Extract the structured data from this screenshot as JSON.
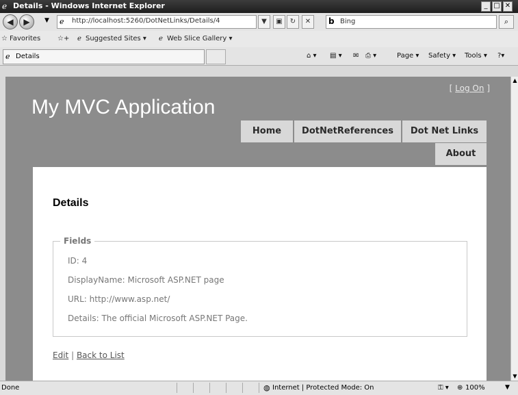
{
  "window": {
    "title": "Details - Windows Internet Explorer"
  },
  "address": {
    "url": "http://localhost:5260/DotNetLinks/Details/4",
    "search_placeholder": "Bing"
  },
  "favorites_bar": {
    "favorites": "Favorites",
    "suggested": "Suggested Sites ▾",
    "webslice": "Web Slice Gallery ▾"
  },
  "tab": {
    "label": "Details"
  },
  "commands": {
    "page": "Page ▾",
    "safety": "Safety ▾",
    "tools": "Tools ▾"
  },
  "site": {
    "logon_prefix": "[",
    "logon_link": "Log On",
    "logon_suffix": "]",
    "title": "My MVC Application",
    "menu": [
      "Home",
      "DotNetReferences",
      "Dot Net Links",
      "About"
    ]
  },
  "details": {
    "heading": "Details",
    "legend": "Fields",
    "fields": [
      "ID: 4",
      "DisplayName: Microsoft ASP.NET page",
      "URL: http://www.asp.net/",
      "Details: The official Microsoft ASP.NET Page."
    ],
    "edit_link": "Edit",
    "separator": "|",
    "back_link": "Back to List"
  },
  "statusbar": {
    "status": "Done",
    "zone": "Internet | Protected Mode: On",
    "zoom": "100%"
  },
  "colors": {
    "page_background": "#8c8c8c",
    "menu_tab": "#d8d8d8",
    "content": "#ffffff"
  }
}
